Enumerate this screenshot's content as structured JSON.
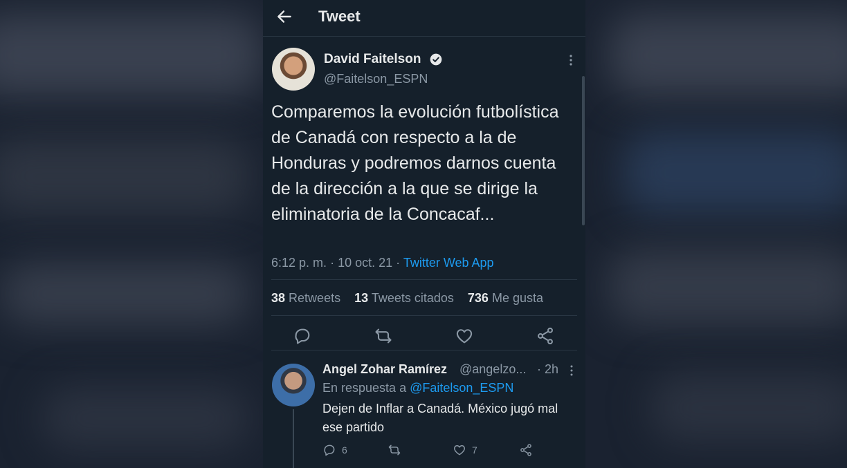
{
  "header": {
    "title": "Tweet"
  },
  "tweet": {
    "author_name": "David Faitelson",
    "author_handle": "@Faitelson_ESPN",
    "text": "Comparemos la evolución futbolística de Canadá con respecto a la de Honduras y podremos darnos cuenta de la dirección a la que se dirige la eliminatoria de la Concacaf...",
    "time": "6:12 p. m.",
    "date": "10 oct. 21",
    "source": "Twitter Web App",
    "stats": {
      "retweets_count": "38",
      "retweets_label": "Retweets",
      "quotes_count": "13",
      "quotes_label": "Tweets citados",
      "likes_count": "736",
      "likes_label": "Me gusta"
    },
    "actions": [
      "reply-icon",
      "retweet-icon",
      "like-icon",
      "share-icon"
    ]
  },
  "reply": {
    "author_name": "Angel Zohar Ramírez",
    "author_handle": "@angelzo...",
    "time": "· 2h",
    "in_reply_prefix": "En respuesta a",
    "in_reply_mention": "@Faitelson_ESPN",
    "text": "Dejen de Inflar a Canadá. México jugó mal ese partido",
    "reply_count": "6",
    "like_count": "7"
  },
  "colors": {
    "background": "#15202b",
    "accent": "#1d9bf0",
    "text": "#e7e9ea",
    "secondary_text": "#8b98a5"
  }
}
